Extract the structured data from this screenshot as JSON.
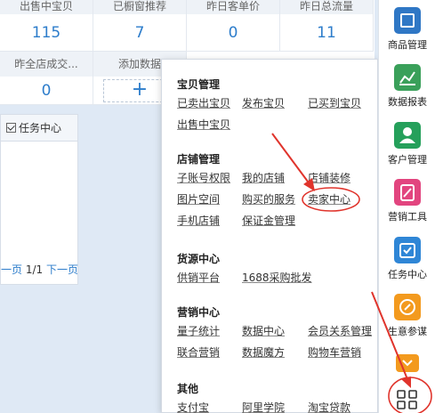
{
  "stats": {
    "row1": [
      {
        "label": "出售中宝贝",
        "value": "115"
      },
      {
        "label": "已橱窗推荐",
        "value": "7"
      },
      {
        "label": "昨日客单价",
        "value": "0"
      },
      {
        "label": "昨日总流量",
        "value": "11"
      }
    ],
    "row2": [
      {
        "label": "昨全店成交...",
        "value": "0"
      },
      {
        "label": "添加数据",
        "value": "+"
      }
    ]
  },
  "task": {
    "title": "任务中心",
    "pager_prev": "一页",
    "pager_page": "1/1",
    "pager_next": "下一页"
  },
  "menu": {
    "groups": [
      {
        "title": "宝贝管理",
        "links": [
          "已卖出宝贝",
          "发布宝贝",
          "已买到宝贝",
          "出售中宝贝"
        ]
      },
      {
        "title": "店铺管理",
        "links": [
          "子账号权限",
          "我的店铺",
          "店铺装修",
          "图片空间",
          "购买的服务",
          "卖家中心",
          "手机店铺",
          "保证金管理"
        ]
      },
      {
        "title": "货源中心",
        "links": [
          "供销平台",
          "1688采购批发"
        ]
      },
      {
        "title": "营销中心",
        "links": [
          "量子统计",
          "数据中心",
          "会员关系管理",
          "联合营销",
          "数据魔方",
          "购物车营销"
        ]
      },
      {
        "title": "其他",
        "links": [
          "支付宝",
          "阿里学院",
          "淘宝贷款"
        ]
      }
    ]
  },
  "toolbar": {
    "items": [
      {
        "label": "商品管理",
        "icon": "product-icon",
        "color": "#2f77c5"
      },
      {
        "label": "数据报表",
        "icon": "chart-icon",
        "color": "#3aa05a"
      },
      {
        "label": "客户管理",
        "icon": "customer-icon",
        "color": "#25a05b"
      },
      {
        "label": "营销工具",
        "icon": "discount-icon",
        "color": "#e2457f"
      },
      {
        "label": "任务中心",
        "icon": "calendar-check-icon",
        "color": "#2f86d6"
      },
      {
        "label": "生意参谋",
        "icon": "compass-icon",
        "color": "#f39a1e"
      }
    ],
    "collapse_icon": "chevron-down-icon",
    "apps_icon": "grid-icon"
  },
  "colors": {
    "annotation_red": "#e0342c",
    "link_blue": "#2d7dcb"
  }
}
